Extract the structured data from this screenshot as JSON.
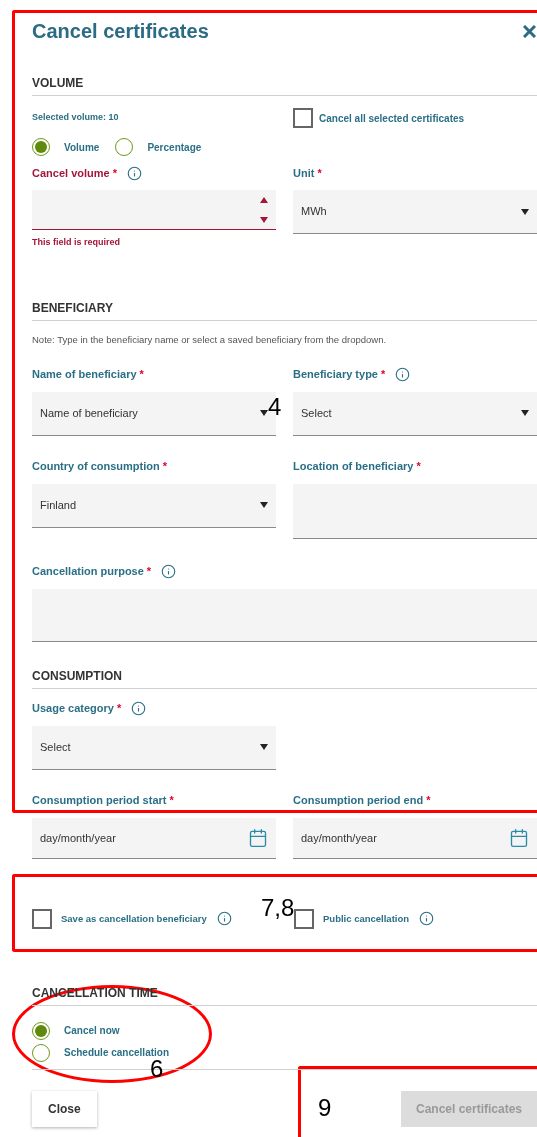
{
  "dialog": {
    "title": "Cancel certificates"
  },
  "volume": {
    "heading": "VOLUME",
    "selected_volume": "Selected volume: 10",
    "cancel_all": {
      "label": "Cancel all selected certificates",
      "checked": false
    },
    "modes": [
      {
        "label": "Volume",
        "selected": true
      },
      {
        "label": "Percentage",
        "selected": false
      }
    ],
    "fields": [
      {
        "kind": "number",
        "label": "Cancel volume",
        "required": "*",
        "info": true,
        "invalid": true,
        "error": "This field is required"
      },
      {
        "kind": "select",
        "label": "Unit",
        "required": "*",
        "invalid": false,
        "value": "MWh"
      }
    ]
  },
  "beneficiary": {
    "heading": "BENEFICIARY",
    "note": "Note: Type in the beneficiary name or select a saved beneficiary from the dropdown.",
    "rows": [
      [
        {
          "kind": "select",
          "label": "Name of beneficiary",
          "required": "*",
          "invalid": false,
          "value": "Name of beneficiary"
        },
        {
          "kind": "select",
          "label": "Beneficiary type",
          "required": "*",
          "info": true,
          "invalid": false,
          "value": "Select"
        }
      ],
      [
        {
          "kind": "select",
          "label": "Country of consumption",
          "required": "*",
          "invalid": false,
          "value": "Finland"
        },
        {
          "kind": "textarea",
          "label": "Location of beneficiary",
          "required": "*",
          "invalid": false
        }
      ],
      [
        {
          "kind": "textarea",
          "label": "Cancellation purpose",
          "required": "*",
          "info": true,
          "invalid": false,
          "wide": true
        }
      ]
    ]
  },
  "consumption": {
    "heading": "CONSUMPTION",
    "rows": [
      [
        {
          "kind": "select",
          "label": "Usage category",
          "required": "*",
          "info": true,
          "invalid": false,
          "value": "Select"
        }
      ],
      [
        {
          "kind": "date",
          "label": "Consumption period start",
          "required": "*",
          "invalid": false,
          "placeholder": "day/month/year"
        },
        {
          "kind": "date",
          "label": "Consumption period end",
          "required": "*",
          "invalid": false,
          "placeholder": "day/month/year"
        }
      ]
    ]
  },
  "options": [
    {
      "label": "Save as cancellation beneficiary",
      "checked": false,
      "info": true
    },
    {
      "label": "Public cancellation",
      "checked": false,
      "info": true
    }
  ],
  "cancellation_time": {
    "heading": "CANCELLATION TIME",
    "choices": [
      {
        "label": "Cancel now",
        "selected": true
      },
      {
        "label": "Schedule cancellation",
        "selected": false
      }
    ]
  },
  "buttons": {
    "close": "Close",
    "submit": {
      "label": "Cancel certificates",
      "disabled": true
    }
  },
  "annotations": [
    {
      "kind": "box",
      "label": "4"
    },
    {
      "kind": "box",
      "label": "7,8"
    },
    {
      "kind": "ellipse",
      "label": "6"
    },
    {
      "kind": "box",
      "label": "9"
    }
  ]
}
